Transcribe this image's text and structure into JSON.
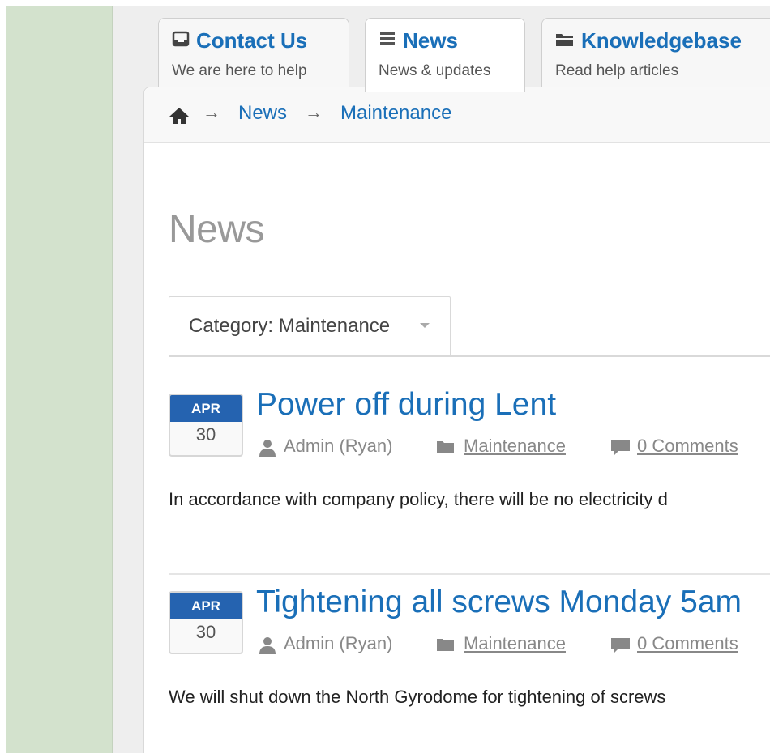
{
  "tabs": [
    {
      "title": "Contact Us",
      "subtitle": "We are here to help",
      "icon": "inbox-icon"
    },
    {
      "title": "News",
      "subtitle": "News & updates",
      "icon": "list-icon"
    },
    {
      "title": "Knowledgebase",
      "subtitle": "Read help articles",
      "icon": "folder-icon"
    }
  ],
  "breadcrumb": {
    "home_icon": "home-icon",
    "separator": "→",
    "items": [
      "News",
      "Maintenance"
    ]
  },
  "page": {
    "title": "News",
    "category_filter": "Category: Maintenance"
  },
  "articles": [
    {
      "month": "APR",
      "day": "30",
      "title": "Power off during Lent",
      "author": "Admin (Ryan)",
      "category": "Maintenance",
      "comments": "0 Comments",
      "excerpt": "In accordance with company policy, there will be no electricity d"
    },
    {
      "month": "APR",
      "day": "30",
      "title": "Tightening all screws Monday 5am",
      "author": "Admin (Ryan)",
      "category": "Maintenance",
      "comments": "0 Comments",
      "excerpt": "We will shut down the North Gyrodome for tightening of screws"
    }
  ],
  "colors": {
    "accent": "#1a6fb8",
    "date_badge": "#2563b0",
    "sidebar": "#d3e2cd"
  }
}
